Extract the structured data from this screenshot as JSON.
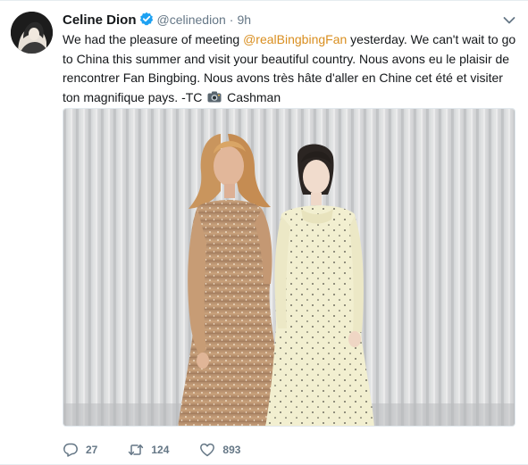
{
  "user": {
    "name": "Celine Dion",
    "handle": "@celinedion",
    "separator": "·",
    "time": "9h"
  },
  "tweet": {
    "text_part1": "We had the pleasure of meeting ",
    "mention": "@realBingbingFan",
    "text_part2": " yesterday. We can't wait to go to China this summer and visit your beautiful country. Nous avons eu le plaisir de rencontrer Fan Bingbing. Nous avons très hâte d'aller en Chine cet été et visiter ton magnifique pays. -TC ",
    "text_part3": " Cashman"
  },
  "actions": {
    "replies": "27",
    "retweets": "124",
    "likes": "893"
  },
  "colors": {
    "mention": "#d98e1f",
    "verified": "#1da1f2",
    "muted": "#657786"
  },
  "icons": [
    "verified-badge-icon",
    "chevron-down-icon",
    "camera-icon",
    "reply-icon",
    "retweet-icon",
    "like-icon"
  ]
}
